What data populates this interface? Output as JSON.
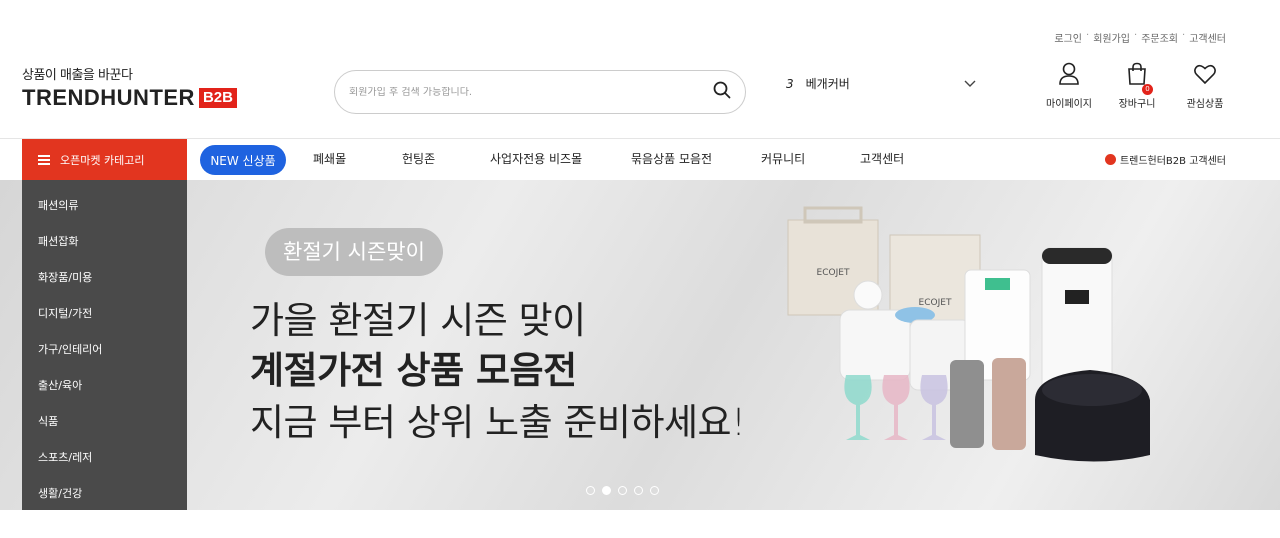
{
  "top_links": [
    "로그인",
    "회원가입",
    "주문조회",
    "고객센터"
  ],
  "top_link_separator": "·",
  "logo": {
    "slogan": "상품이 매출을 바꾼다",
    "text": "TRENDHUNTER",
    "badge": "B2B"
  },
  "search": {
    "placeholder": "회원가입 후 검색 가능합니다."
  },
  "rank": {
    "number": "3",
    "keyword": "베개커버"
  },
  "header_icons": {
    "mypage": "마이페이지",
    "cart": "장바구니",
    "cart_count": "0",
    "wishlist": "관심상품"
  },
  "nav": {
    "category_button": "오픈마켓 카테고리",
    "new_button": "NEW 신상품",
    "items": [
      "폐쇄몰",
      "헌팅존",
      "사업자전용 비즈몰",
      "묶음상품 모음전",
      "커뮤니티",
      "고객센터"
    ],
    "cs_link": "트렌드헌터B2B 고객센터"
  },
  "categories": [
    "패션의류",
    "패션잡화",
    "화장품/미용",
    "디지털/가전",
    "가구/인테리어",
    "출산/육아",
    "식품",
    "스포츠/레저",
    "생활/건강"
  ],
  "hero": {
    "badge": "환절기 시즌맞이",
    "line1": "가을 환절기 시즌 맞이",
    "line2": "계절가전 상품 모음전",
    "line3": "지금 부터 상위 노출 준비하세요!",
    "product_labels": [
      "ECOJET",
      "ECOJET"
    ],
    "slide_count": 5,
    "active_slide": 2
  },
  "colors": {
    "brand_red": "#e2231a",
    "new_blue": "#1f63e0",
    "sidebar_bg": "#4a4a4a"
  }
}
